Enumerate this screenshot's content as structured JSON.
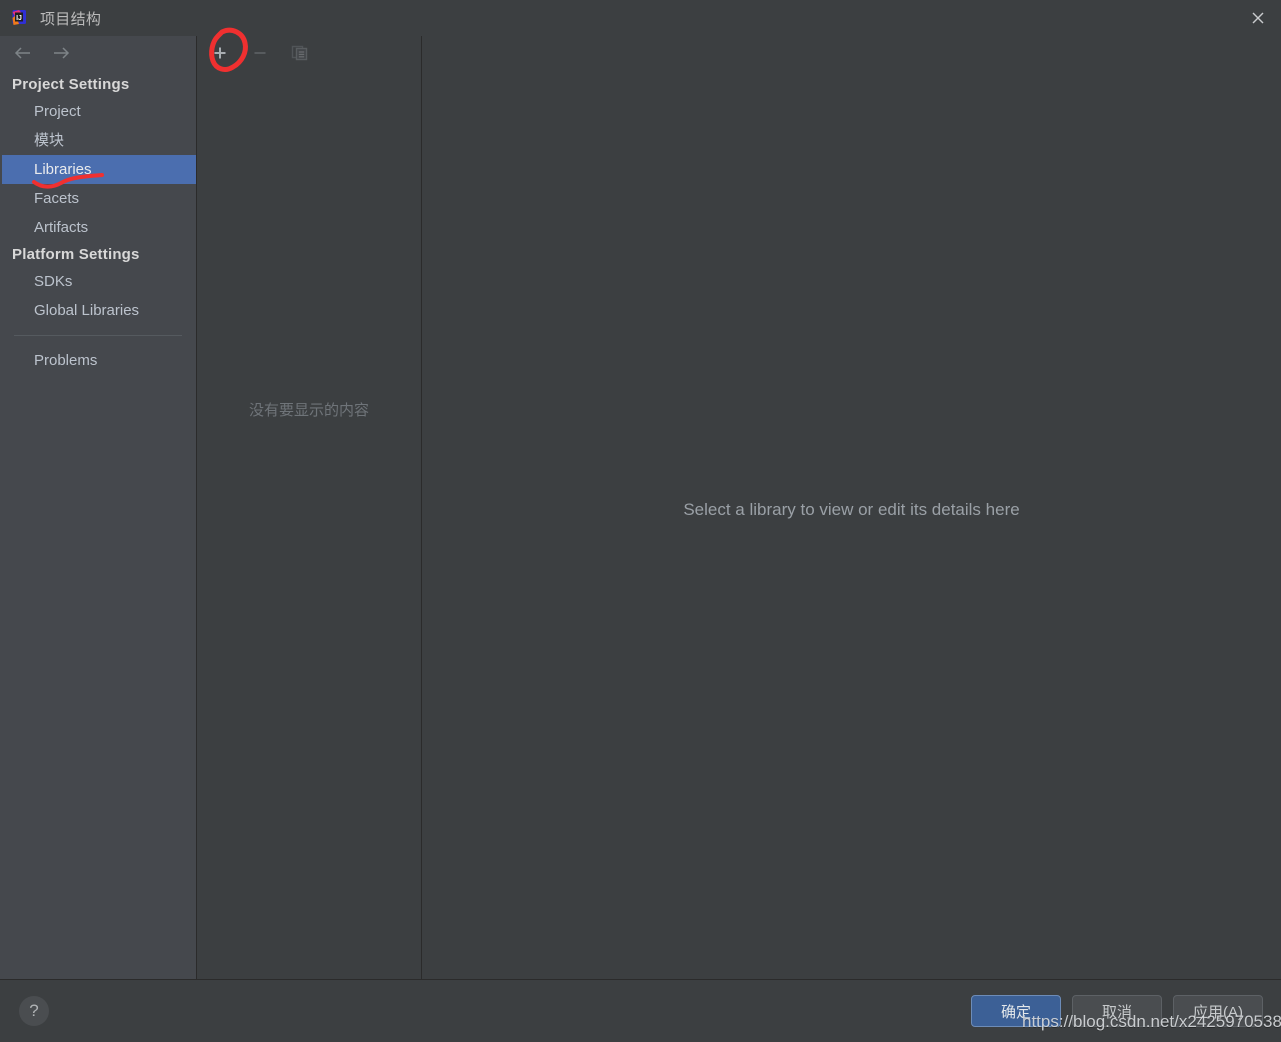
{
  "window": {
    "title": "项目结构",
    "app_icon": "intellij-idea-logo",
    "close_icon": "close-icon"
  },
  "sidebar": {
    "nav": {
      "back_icon": "arrow-left-icon",
      "forward_icon": "arrow-right-icon"
    },
    "groups": [
      {
        "title": "Project Settings",
        "items": [
          {
            "label": "Project",
            "selected": false
          },
          {
            "label": "模块",
            "selected": false
          },
          {
            "label": "Libraries",
            "selected": true
          },
          {
            "label": "Facets",
            "selected": false
          },
          {
            "label": "Artifacts",
            "selected": false
          }
        ]
      },
      {
        "title": "Platform Settings",
        "items": [
          {
            "label": "SDKs",
            "selected": false
          },
          {
            "label": "Global Libraries",
            "selected": false
          }
        ]
      }
    ],
    "extra_items": [
      {
        "label": "Problems",
        "selected": false
      }
    ]
  },
  "middle_panel": {
    "toolbar": [
      {
        "name": "add-library-button",
        "icon": "plus-icon",
        "enabled": true,
        "annotated": true
      },
      {
        "name": "remove-library-button",
        "icon": "minus-icon",
        "enabled": false
      },
      {
        "name": "copy-library-button",
        "icon": "copy-icon",
        "enabled": false
      }
    ],
    "empty_text": "没有要显示的内容"
  },
  "detail_panel": {
    "message": "Select a library to view or edit its details here"
  },
  "footer": {
    "help_icon": "question-mark-icon",
    "help_label": "?",
    "buttons": [
      {
        "label": "确定",
        "primary": true
      },
      {
        "label": "取消",
        "primary": false
      },
      {
        "label": "应用(A)",
        "primary": false
      }
    ]
  },
  "annotations": {
    "color": "#f03030",
    "circle_target": "add-library-button",
    "underline_target": "sidebar-item-libraries"
  },
  "watermark": {
    "text": "https://blog.csdn.net/x2425970538"
  }
}
